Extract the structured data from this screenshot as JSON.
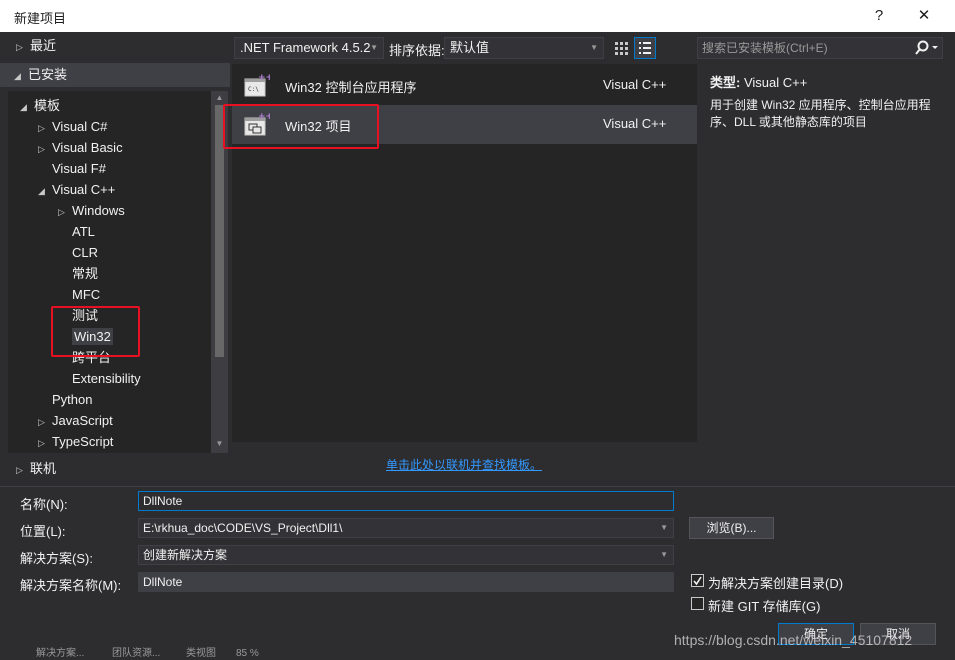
{
  "window": {
    "title": "新建项目",
    "help": "?",
    "close": "✕"
  },
  "left": {
    "recent": "最近",
    "installed": "已安装",
    "templates": "模板",
    "tree": [
      {
        "label": "Visual C#",
        "arrow": "▷"
      },
      {
        "label": "Visual Basic",
        "arrow": "▷"
      },
      {
        "label": "Visual F#",
        "arrow": ""
      },
      {
        "label": "Visual C++",
        "arrow": "◢"
      },
      {
        "label": "Windows",
        "arrow": "▷"
      },
      {
        "label": "ATL",
        "arrow": ""
      },
      {
        "label": "CLR",
        "arrow": ""
      },
      {
        "label": "常规",
        "arrow": ""
      },
      {
        "label": "MFC",
        "arrow": ""
      },
      {
        "label": "测试",
        "arrow": ""
      },
      {
        "label": "Win32",
        "arrow": ""
      },
      {
        "label": "跨平台",
        "arrow": ""
      },
      {
        "label": "Extensibility",
        "arrow": ""
      },
      {
        "label": "Python",
        "arrow": ""
      },
      {
        "label": "JavaScript",
        "arrow": "▷"
      },
      {
        "label": "TypeScript",
        "arrow": "▷"
      }
    ],
    "online": "联机"
  },
  "toolbar": {
    "framework": ".NET Framework 4.5.2",
    "sort_label": "排序依据:",
    "sort_value": "默认值",
    "search_placeholder": "搜索已安装模板(Ctrl+E)"
  },
  "projects": [
    {
      "name": "Win32 控制台应用程序",
      "lang": "Visual C++"
    },
    {
      "name": "Win32 项目",
      "lang": "Visual C++"
    }
  ],
  "online_link": "单击此处以联机并查找模板。",
  "details": {
    "type_label": "类型:",
    "type_value": "Visual C++",
    "description": "用于创建 Win32 应用程序、控制台应用程序、DLL 或其他静态库的项目"
  },
  "form": {
    "name_label": "名称(N):",
    "name_value": "DllNote",
    "location_label": "位置(L):",
    "location_value": "E:\\rkhua_doc\\CODE\\VS_Project\\Dll1\\",
    "browse": "浏览(B)...",
    "solution_label": "解决方案(S):",
    "solution_value": "创建新解决方案",
    "solution_name_label": "解决方案名称(M):",
    "solution_name_value": "DllNote",
    "create_dir": "为解决方案创建目录(D)",
    "create_git": "新建 GIT 存储库(G)",
    "ok": "确定",
    "cancel": "取消"
  },
  "watermark": "https://blog.csdn.net/weixin_45107812",
  "statusbar": {
    "item1": "解决方案...",
    "item2": "团队资源...",
    "item3": "类视图",
    "zoom": "85 %"
  },
  "colors": {
    "accent": "#007acc",
    "highlight": "#e81123",
    "link": "#3399ff"
  }
}
